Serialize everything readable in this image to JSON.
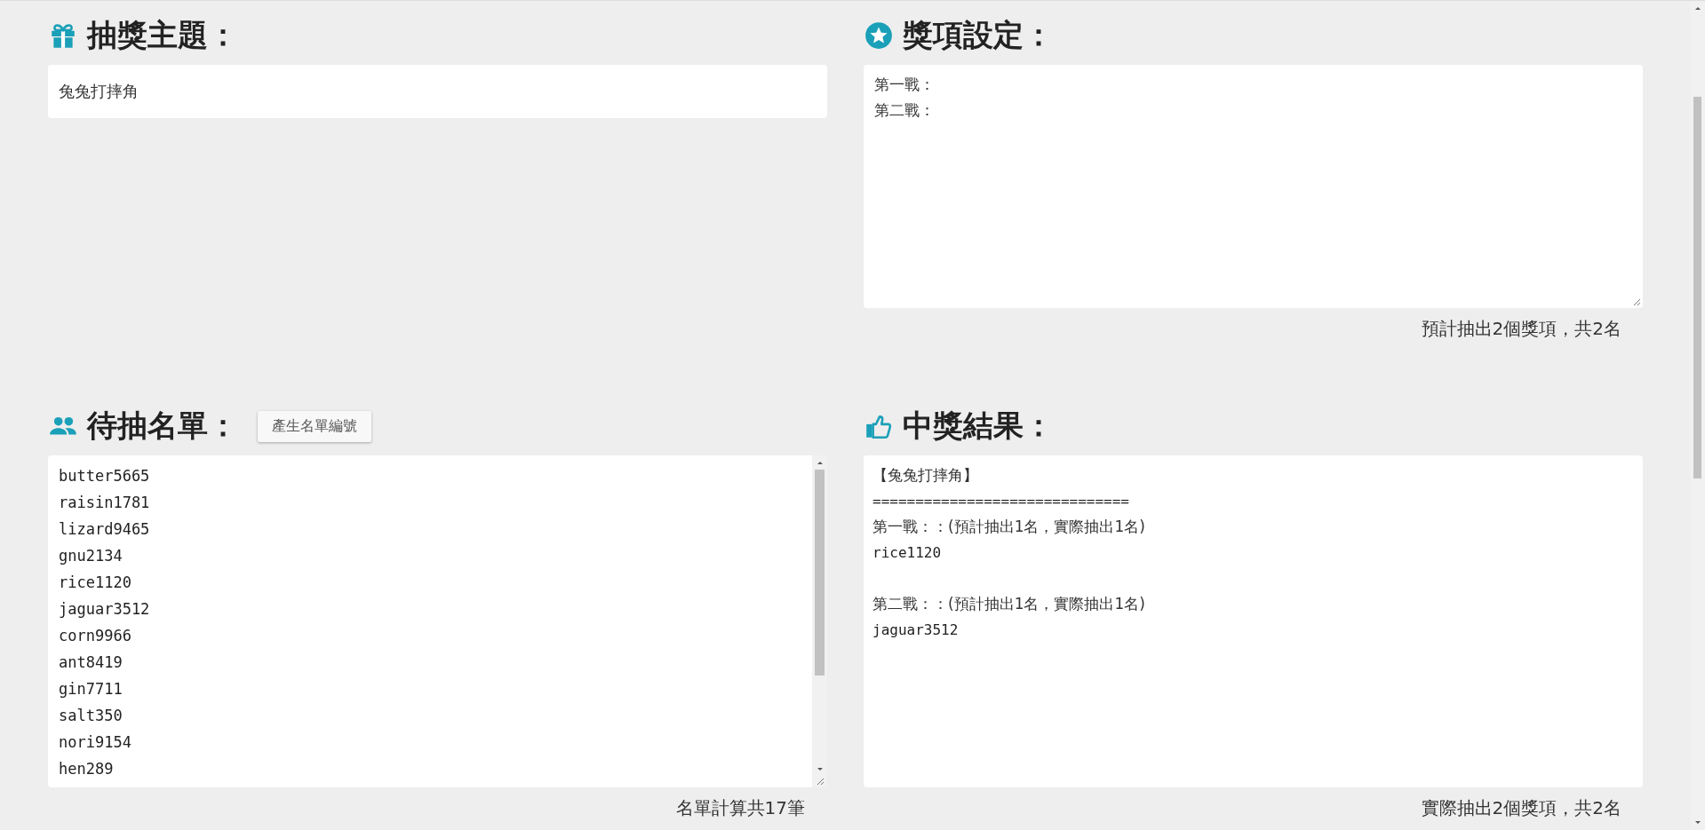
{
  "topic": {
    "heading": "抽獎主題：",
    "value": "兔兔打摔角"
  },
  "prizes": {
    "heading": "獎項設定：",
    "lines": [
      "第一戰：",
      "第二戰："
    ],
    "summary": "預計抽出2個獎項，共2名"
  },
  "entrants": {
    "heading": "待抽名單：",
    "button": "產生名單編號",
    "names": [
      "butter5665",
      "raisin1781",
      "lizard9465",
      "gnu2134",
      "rice1120",
      "jaguar3512",
      "corn9966",
      "ant8419",
      "gin7711",
      "salt350",
      "nori9154",
      "hen289"
    ],
    "summary": "名單計算共17筆"
  },
  "results": {
    "heading": "中獎結果：",
    "title": "【兔兔打摔角】",
    "separator": "==============================",
    "groups": [
      {
        "label": "第一戰：：(預計抽出1名，實際抽出1名)",
        "winners": [
          "rice1120"
        ]
      },
      {
        "label": "第二戰：：(預計抽出1名，實際抽出1名)",
        "winners": [
          "jaguar3512"
        ]
      }
    ],
    "summary": "實際抽出2個獎項，共2名"
  }
}
